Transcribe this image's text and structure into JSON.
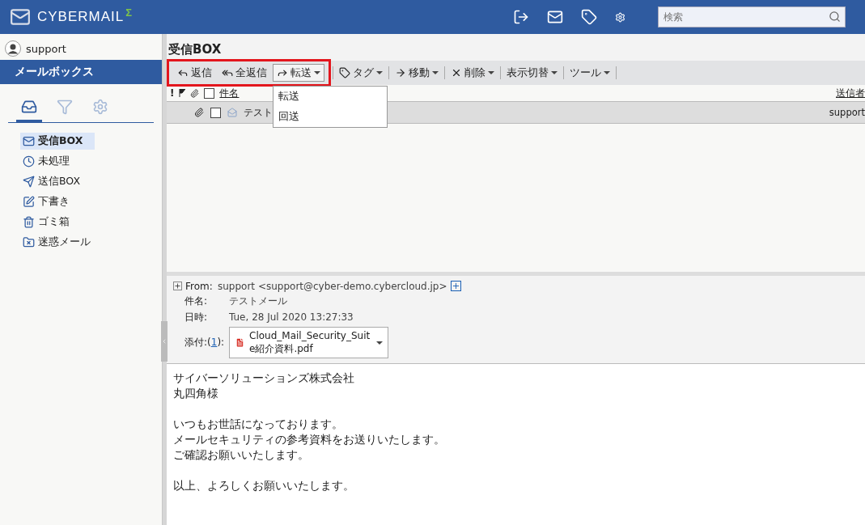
{
  "header": {
    "logo": "CYBERMAIL",
    "logo_mark": "Σ",
    "icons": [
      {
        "kind": "door"
      },
      {
        "kind": "mail"
      },
      {
        "kind": "tag"
      },
      {
        "kind": "gear"
      }
    ],
    "search": {
      "placeholder": "検索"
    }
  },
  "sidebar": {
    "user": "support",
    "section_title": "メールボックス",
    "icon_tabs": [
      {
        "kind": "mailbox",
        "selected": true
      },
      {
        "kind": "filter",
        "selected": false
      },
      {
        "kind": "settings",
        "selected": false
      }
    ],
    "folders": [
      {
        "kind": "inbox",
        "label": "受信BOX",
        "selected": true
      },
      {
        "kind": "clock",
        "label": "未処理",
        "selected": false
      },
      {
        "kind": "sent",
        "label": "送信BOX",
        "selected": false
      },
      {
        "kind": "draft",
        "label": "下書き",
        "selected": false
      },
      {
        "kind": "trash",
        "label": "ゴミ箱",
        "selected": false
      },
      {
        "kind": "spam",
        "label": "迷惑メール",
        "selected": false
      }
    ]
  },
  "main": {
    "title": "受信BOX",
    "toolbar": {
      "highlighted_group": [
        {
          "kind": "reply",
          "label": "返信",
          "dropdown": false
        },
        {
          "kind": "replyall",
          "label": "全返信",
          "dropdown": false
        },
        {
          "kind": "forward",
          "label": "転送",
          "dropdown": true
        }
      ],
      "others": [
        {
          "kind": "tag",
          "label": "タグ",
          "dropdown": true
        },
        {
          "kind": "move",
          "label": "移動",
          "dropdown": true
        },
        {
          "kind": "delete",
          "label": "削除",
          "dropdown": true
        },
        {
          "kind": "none",
          "label": "表示切替",
          "dropdown": true
        },
        {
          "kind": "none",
          "label": "ツール",
          "dropdown": true
        }
      ]
    },
    "forward_menu": [
      "転送",
      "回送"
    ],
    "columns": {
      "select_all_checked": false,
      "flag_mark": "!",
      "subject": "件名",
      "sender": "送信者"
    },
    "rows": [
      {
        "subject": "テスト",
        "sender": "support",
        "attachment": true,
        "checked": false
      }
    ],
    "preview": {
      "fields": [
        {
          "label": "From:",
          "value": "support <support@cyber-demo.cybercloud.jp>"
        },
        {
          "label": "件名:",
          "value": "テストメール"
        },
        {
          "label": "日時:",
          "value": "Tue, 28 Jul 2020 13:27:33"
        }
      ],
      "attachment_label": "添付:(",
      "attachment_count": "1",
      "attachment_close": "):",
      "attachment_file": "Cloud_Mail_Security_Suite紹介資料.pdf",
      "body": [
        [
          "サイバーソリューションズ株式会社",
          "丸四角様"
        ],
        [
          "いつもお世話になっております。",
          "メールセキュリティの参考資料をお送りいたします。",
          "ご確認お願いいたします。"
        ],
        [
          "以上、よろしくお願いいたします。"
        ]
      ]
    }
  }
}
